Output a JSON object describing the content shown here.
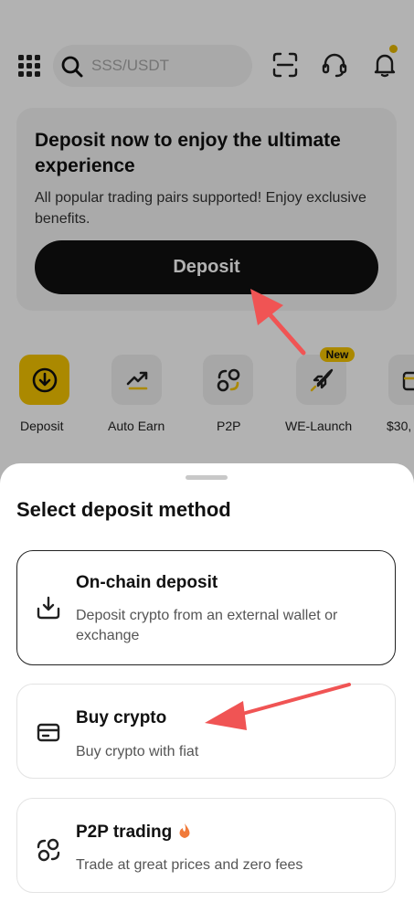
{
  "header": {
    "search_placeholder": "SSS/USDT"
  },
  "promo": {
    "title": "Deposit now to enjoy the ultimate experience",
    "subtitle": "All popular trading pairs supported! Enjoy exclusive benefits.",
    "button_label": "Deposit"
  },
  "quick_actions": [
    {
      "label": "Deposit",
      "icon": "deposit-icon"
    },
    {
      "label": "Auto Earn",
      "icon": "chart-up-icon"
    },
    {
      "label": "P2P",
      "icon": "p2p-icon"
    },
    {
      "label": "WE-Launch",
      "icon": "rocket-icon",
      "badge": "New"
    },
    {
      "label": "$30,",
      "icon": "gift-icon"
    }
  ],
  "sheet": {
    "title": "Select deposit method",
    "options": [
      {
        "title": "On-chain deposit",
        "desc": "Deposit crypto from an external wallet or exchange",
        "icon": "download-tray-icon"
      },
      {
        "title": "Buy crypto",
        "desc": "Buy crypto with fiat",
        "icon": "card-icon"
      },
      {
        "title": "P2P trading",
        "desc": "Trade at great prices and zero fees",
        "icon": "p2p-icon",
        "extra_icon": "fire-icon"
      }
    ]
  },
  "colors": {
    "accent_yellow": "#f5c400",
    "dark": "#111111",
    "annotation_arrow": "#f05454"
  }
}
